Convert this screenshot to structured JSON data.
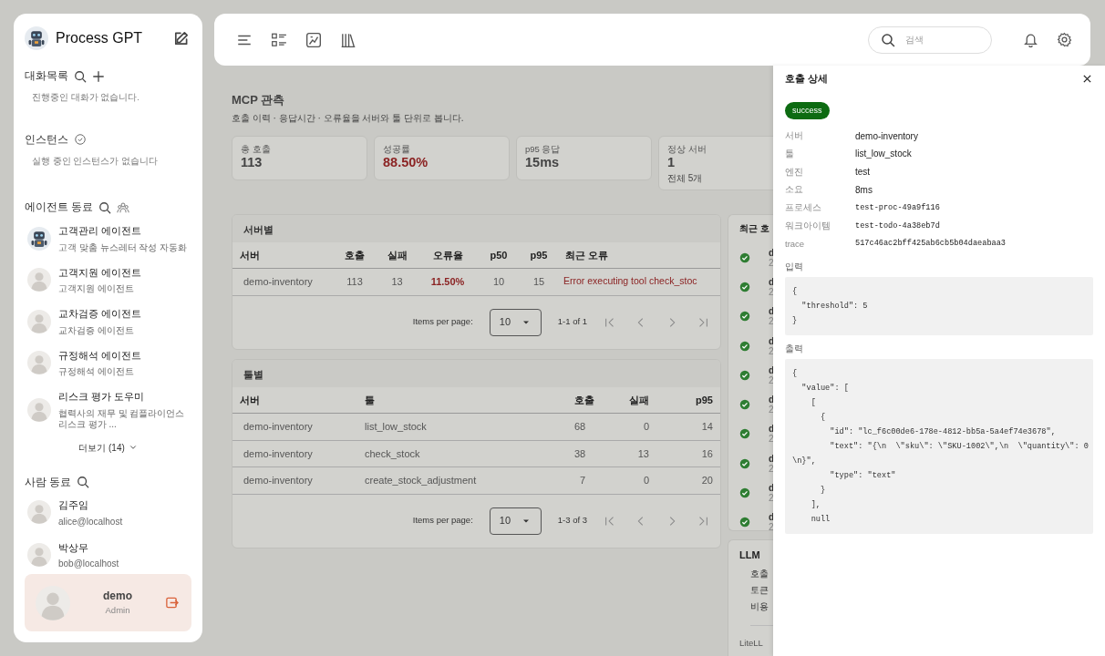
{
  "sidebar": {
    "brand": "Process GPT",
    "chats": {
      "title": "대화목록",
      "empty": "진행중인 대화가 없습니다."
    },
    "instances": {
      "title": "인스턴스",
      "empty": "실행 중인 인스턴스가 없습니다"
    },
    "agents": {
      "title": "에이전트 동료",
      "more": "더보기 (14)",
      "items": [
        {
          "name": "고객관리 에이전트",
          "desc": "고객 맞춤 뉴스레터 작성 자동화",
          "kind": "robot"
        },
        {
          "name": "고객지원 에이전트",
          "desc": "고객지원 에이전트",
          "kind": "person"
        },
        {
          "name": "교차검증 에이전트",
          "desc": "교차검증 에이전트",
          "kind": "person"
        },
        {
          "name": "규정해석 에이전트",
          "desc": "규정해석 에이전트",
          "kind": "person"
        },
        {
          "name": "리스크 평가 도우미",
          "desc": "협력사의 재무 및 컴플라이언스 리스크 평가 ...",
          "kind": "person"
        }
      ]
    },
    "people": {
      "title": "사람 동료",
      "items": [
        {
          "name": "김주임",
          "email": "alice@localhost"
        },
        {
          "name": "박상무",
          "email": "bob@localhost"
        }
      ]
    },
    "user": {
      "name": "demo",
      "role": "Admin"
    }
  },
  "header": {
    "search": {
      "placeholder": "검색"
    }
  },
  "page": {
    "title": "MCP 관측",
    "subtitle": "호출 이력 · 응답시간 · 오류율을 서버와 툴 단위로 봅니다.",
    "stats": [
      {
        "label": "총 호출",
        "value": "113",
        "color": "#444444"
      },
      {
        "label": "성공률",
        "value": "88.50%",
        "color": "#8b2323"
      },
      {
        "label": "p95 응답",
        "value": "15ms",
        "color": "#444444"
      },
      {
        "label": "정상 서버",
        "value": "1",
        "sub": "전체 5개",
        "color": "#444444"
      }
    ],
    "server_table": {
      "title": "서버별",
      "columns": [
        "서버",
        "호출",
        "실패",
        "오류율",
        "p50",
        "p95",
        "최근 오류"
      ],
      "rows": [
        {
          "cells": [
            {
              "text": "demo-inventory"
            },
            {
              "text": "113"
            },
            {
              "text": "13"
            },
            {
              "text": "11.50%",
              "color": "#8b2323",
              "kind": "strong"
            },
            {
              "text": "10"
            },
            {
              "text": "15"
            },
            {
              "text": "Error executing tool check_stoc",
              "color": "#8b2323"
            }
          ]
        }
      ],
      "pagination": {
        "label": "Items per page:",
        "per_page": "10",
        "range": "1-1 of 1"
      }
    },
    "tool_table": {
      "title": "툴별",
      "columns": [
        "서버",
        "툴",
        "호출",
        "실패",
        "p95"
      ],
      "rows": [
        {
          "cells": [
            {
              "text": "demo-inventory"
            },
            {
              "text": "list_low_stock"
            },
            {
              "text": "68"
            },
            {
              "text": "0"
            },
            {
              "text": "14"
            }
          ]
        },
        {
          "cells": [
            {
              "text": "demo-inventory"
            },
            {
              "text": "check_stock"
            },
            {
              "text": "38"
            },
            {
              "text": "13"
            },
            {
              "text": "16"
            }
          ]
        },
        {
          "cells": [
            {
              "text": "demo-inventory"
            },
            {
              "text": "create_stock_adjustment"
            },
            {
              "text": "7"
            },
            {
              "text": "0"
            },
            {
              "text": "20"
            }
          ]
        }
      ],
      "pagination": {
        "label": "Items per page:",
        "per_page": "10",
        "range": "1-3 of 3"
      }
    },
    "recent": {
      "title": "최근 호",
      "items": [
        {
          "kind": "success",
          "line1": "d",
          "line2": "2"
        },
        {
          "kind": "success",
          "line1": "d",
          "line2": "2"
        },
        {
          "kind": "success",
          "line1": "d",
          "line2": "2"
        },
        {
          "kind": "success",
          "line1": "d",
          "line2": "2"
        },
        {
          "kind": "success",
          "line1": "d",
          "line2": "2"
        },
        {
          "kind": "success",
          "line1": "d",
          "line2": "2"
        },
        {
          "kind": "success",
          "line1": "d",
          "line2": "2"
        },
        {
          "kind": "success",
          "line1": "d",
          "line2": "2"
        },
        {
          "kind": "success",
          "line1": "d",
          "line2": "2"
        },
        {
          "kind": "success",
          "line1": "d",
          "line2": "2"
        }
      ]
    },
    "llm": {
      "title": "LLM",
      "labels": [
        "호출",
        "토큰",
        "비용"
      ],
      "footer": "LiteLL"
    }
  },
  "drawer": {
    "title": "호출 상세",
    "status": "success",
    "fields": [
      {
        "label": "서버",
        "value": "demo-inventory",
        "kind": "text"
      },
      {
        "label": "툴",
        "value": "list_low_stock",
        "kind": "text"
      },
      {
        "label": "엔진",
        "value": "test",
        "kind": "text"
      },
      {
        "label": "소요",
        "value": "8ms",
        "kind": "text"
      },
      {
        "label": "프로세스",
        "value": "test-proc-49a9f116",
        "kind": "mono"
      },
      {
        "label": "워크아이템",
        "value": "test-todo-4a38eb7d",
        "kind": "mono"
      },
      {
        "label": "trace",
        "value": "517c46ac2bff425ab6cb5b04daeabaa3",
        "kind": "mono"
      }
    ],
    "input": {
      "label": "입력",
      "lines": [
        "{",
        "  \"threshold\": 5",
        "}"
      ]
    },
    "output": {
      "label": "출력",
      "lines": [
        "{",
        "  \"value\": [",
        "    [",
        "      {",
        "        \"id\": \"lc_f6c00de6-178e-4812-bb5a-5a4ef74e3678\",",
        "        \"text\": \"{\\n  \\\"sku\\\": \\\"SKU-1002\\\",\\n  \\\"quantity\\\": 0",
        "\\n}\",",
        "        \"type\": \"text\"",
        "      }",
        "    ],",
        "    null"
      ]
    }
  }
}
